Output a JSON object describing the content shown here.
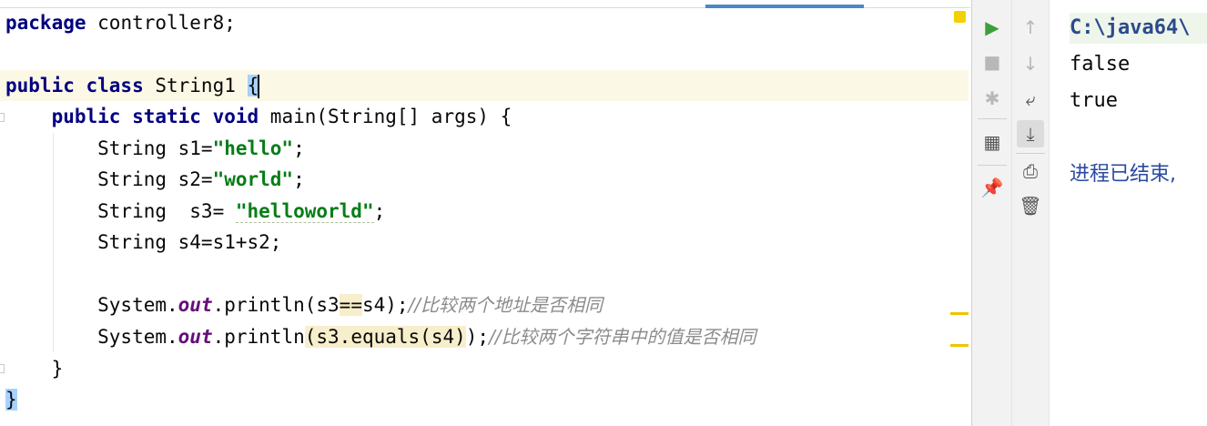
{
  "editor": {
    "package_line": [
      {
        "t": "package",
        "c": "kw"
      },
      {
        "t": " controller8;",
        "c": ""
      }
    ],
    "class_line": [
      {
        "t": "public class",
        "c": "kw"
      },
      {
        "t": " String1 ",
        "c": ""
      },
      {
        "t": "{",
        "c": "brace-hl"
      }
    ],
    "main_line": [
      {
        "t": "    ",
        "c": ""
      },
      {
        "t": "public static void",
        "c": "kw"
      },
      {
        "t": " main(String[] args) {",
        "c": ""
      }
    ],
    "s1_line": [
      {
        "t": "        String s1=",
        "c": ""
      },
      {
        "t": "\"hello\"",
        "c": "str"
      },
      {
        "t": ";",
        "c": ""
      }
    ],
    "s2_line": [
      {
        "t": "        String s2=",
        "c": ""
      },
      {
        "t": "\"world\"",
        "c": "str"
      },
      {
        "t": ";",
        "c": ""
      }
    ],
    "s3_line": [
      {
        "t": "        String  s3= ",
        "c": ""
      },
      {
        "t": "\"helloworld\"",
        "c": "str squiggle"
      },
      {
        "t": ";",
        "c": ""
      }
    ],
    "s4_line": [
      {
        "t": "        String s4=s1+s2;",
        "c": ""
      }
    ],
    "print1_line": [
      {
        "t": "        System.",
        "c": ""
      },
      {
        "t": "out",
        "c": "fld"
      },
      {
        "t": ".println(s3",
        "c": ""
      },
      {
        "t": "==",
        "c": "hl"
      },
      {
        "t": "s4);",
        "c": ""
      },
      {
        "t": "//比较两个地址是否相同",
        "c": "cmt"
      }
    ],
    "print2_line": [
      {
        "t": "        System.",
        "c": ""
      },
      {
        "t": "out",
        "c": "fld"
      },
      {
        "t": ".println",
        "c": ""
      },
      {
        "t": "(s3.equals(s4)",
        "c": "hl"
      },
      {
        "t": ");",
        "c": ""
      },
      {
        "t": "//比较两个字符串中的值是否相同",
        "c": "cmt"
      }
    ],
    "close_method_line": [
      {
        "t": "    }",
        "c": ""
      }
    ],
    "close_class_line": [
      {
        "t": "}",
        "c": "brace-hl"
      }
    ]
  },
  "run_toolbar": {
    "left": [
      {
        "icon": "run-icon",
        "glyph": "▶",
        "color": "#3c9e3c"
      },
      {
        "icon": "stop-icon",
        "glyph": "■",
        "color": "#b8b8b8"
      },
      {
        "icon": "debug-icon",
        "glyph": "✱",
        "color": "#b8b8b8"
      },
      {
        "icon": "layout-icon",
        "glyph": "▦",
        "color": "#555555"
      },
      {
        "icon": "pin-icon",
        "glyph": "📌",
        "color": "#555555"
      }
    ],
    "right": [
      {
        "icon": "up-arrow-icon",
        "glyph": "↑",
        "color": "#b8b8b8"
      },
      {
        "icon": "down-arrow-icon",
        "glyph": "↓",
        "color": "#b8b8b8"
      },
      {
        "icon": "soft-wrap-icon",
        "glyph": "⤶",
        "color": "#555555"
      },
      {
        "icon": "scroll-to-end-icon",
        "glyph": "⤓",
        "color": "#555555"
      },
      {
        "icon": "print-icon",
        "glyph": "⎙",
        "color": "#555555"
      },
      {
        "icon": "trash-icon",
        "glyph": "🗑",
        "color": "#555555"
      }
    ]
  },
  "console": {
    "command": "C:\\java64\\",
    "out1": "false",
    "out2": "true",
    "exit": "进程已结束,"
  }
}
